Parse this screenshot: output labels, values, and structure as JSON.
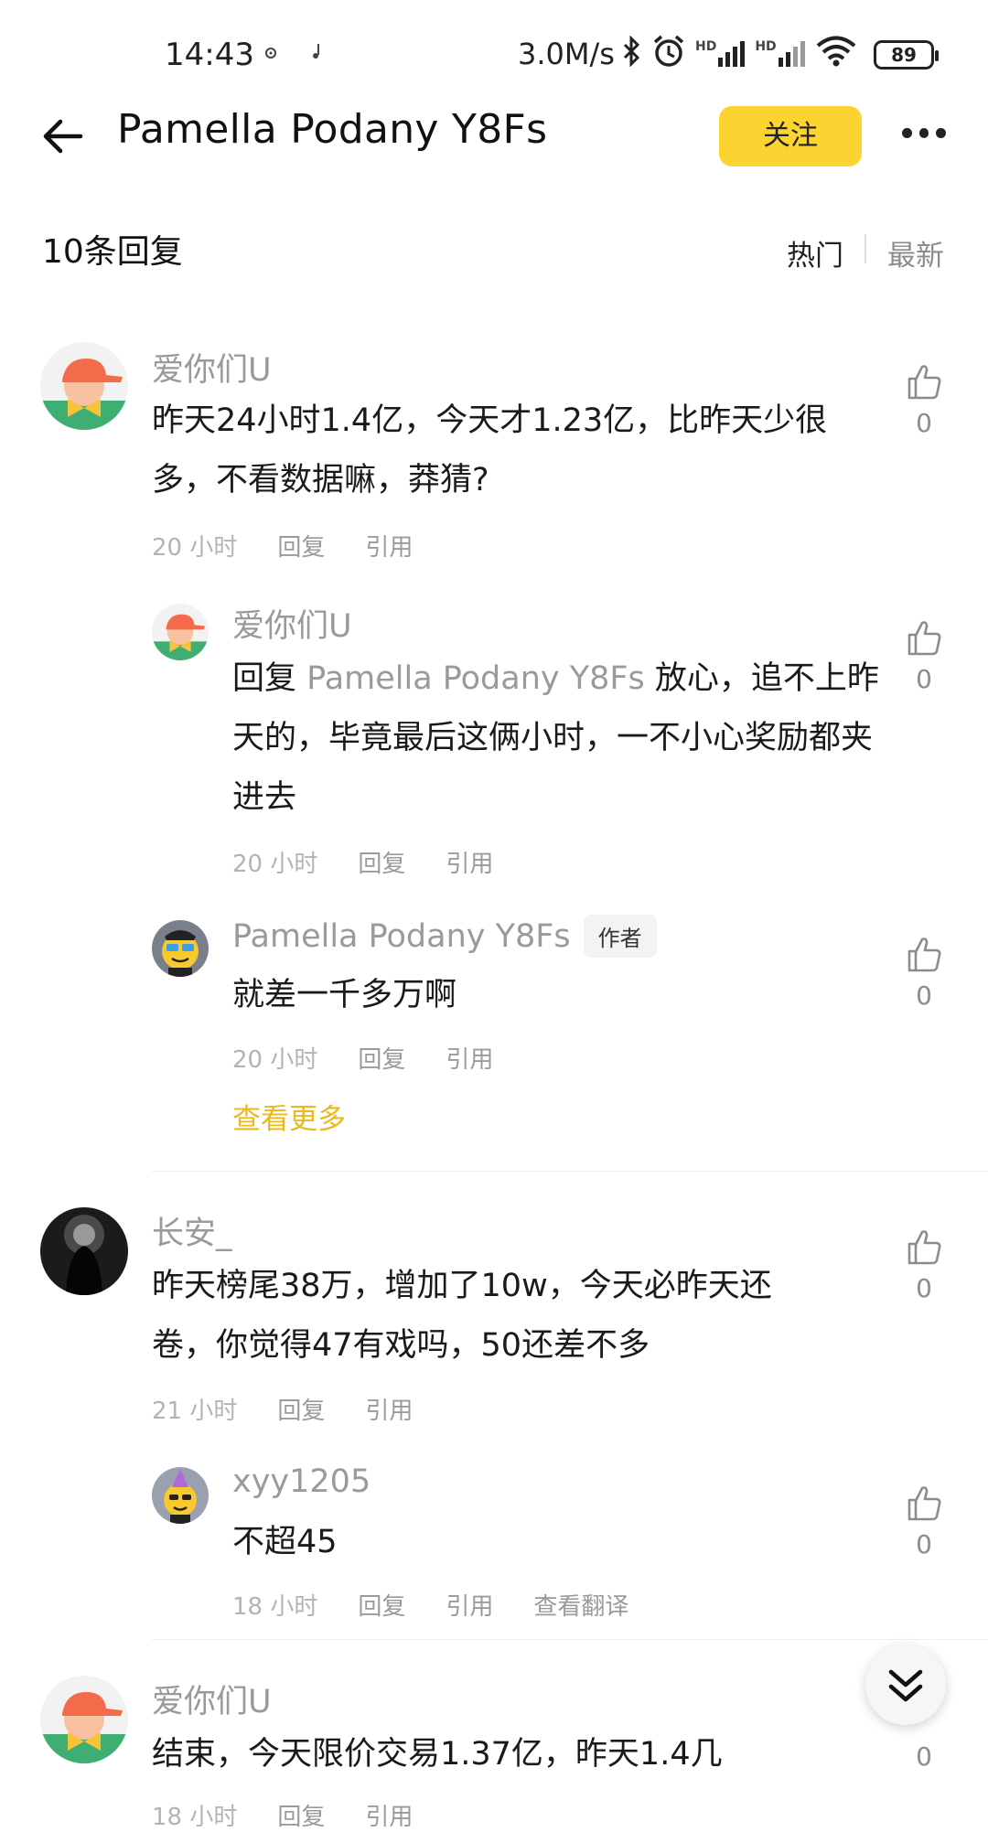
{
  "status": {
    "time": "14:43",
    "speed": "3.0M/s",
    "battery": "89",
    "hd1": "HD",
    "hd2": "HD"
  },
  "header": {
    "title": "Pamella Podany Y8Fs",
    "follow_label": "关注"
  },
  "list_header": {
    "count": "10条回复",
    "sort_hot": "热门",
    "sort_new": "最新"
  },
  "actions": {
    "reply": "回复",
    "quote": "引用",
    "translate": "查看翻译"
  },
  "comments": [
    {
      "user": "爱你们U",
      "text": "昨天24小时1.4亿，今天才1.23亿，比昨天少很多，不看数据嘛，莽猜?",
      "time": "20 小时",
      "likes": "0"
    },
    {
      "user": "爱你们U",
      "reply_prefix": "回复",
      "reply_to": "Pamella Podany Y8Fs",
      "text": "放心，追不上昨天的，毕竟最后这俩小时，一不小心奖励都夹进去",
      "time": "20 小时",
      "likes": "0"
    },
    {
      "user": "Pamella Podany Y8Fs",
      "badge": "作者",
      "text": "就差一千多万啊",
      "time": "20 小时",
      "likes": "0"
    },
    {
      "user": "长安_",
      "text": "昨天榜尾38万，增加了10w，今天必昨天还卷，你觉得47有戏吗，50还差不多",
      "time": "21 小时",
      "likes": "0"
    },
    {
      "user": "xyy1205",
      "text": "不超45",
      "time": "18 小时",
      "likes": "0"
    },
    {
      "user": "爱你们U",
      "text": "结束，今天限价交易1.37亿，昨天1.4几",
      "time": "18 小时",
      "likes": "0"
    }
  ],
  "see_more": "查看更多",
  "colors": {
    "accent": "#fbd431",
    "see_more": "#e9b91d"
  }
}
